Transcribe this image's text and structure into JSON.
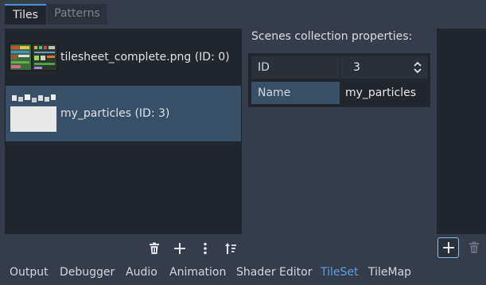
{
  "tabs": [
    {
      "label": "Tiles",
      "active": true
    },
    {
      "label": "Patterns",
      "active": false
    }
  ],
  "sources": [
    {
      "label": "tilesheet_complete.png (ID: 0)",
      "selected": false
    },
    {
      "label": "my_particles (ID: 3)",
      "selected": true
    }
  ],
  "list_toolbar": {
    "icons": [
      "trash-icon",
      "add-icon",
      "more-vertical-icon",
      "sort-icon"
    ]
  },
  "properties": {
    "title": "Scenes collection properties:",
    "id_key": "ID",
    "id_value": "3",
    "name_key": "Name",
    "name_value": "my_particles"
  },
  "right_toolbar": {
    "icons": [
      "add-icon",
      "trash-icon"
    ]
  },
  "bottom_tabs": [
    {
      "label": "Output"
    },
    {
      "label": "Debugger"
    },
    {
      "label": "Audio"
    },
    {
      "label": "Animation"
    },
    {
      "label": "Shader Editor"
    },
    {
      "label": "TileSet",
      "active": true
    },
    {
      "label": "TileMap"
    }
  ],
  "colors": {
    "accent": "#5aa0ea",
    "selection": "#384f66",
    "panel": "#21262e",
    "background": "#363d4a"
  }
}
